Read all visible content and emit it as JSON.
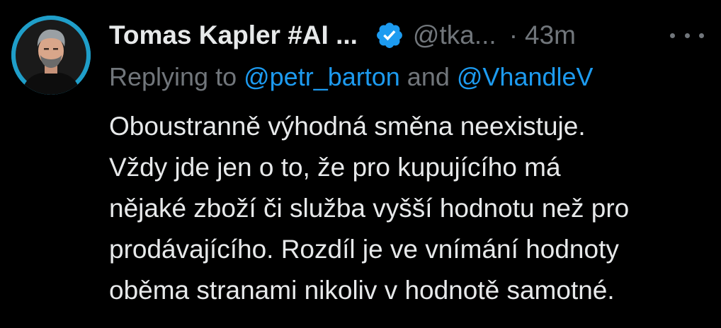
{
  "author": {
    "display_name": "Tomas Kapler #AI ...",
    "handle": "@tka...",
    "separator": "·",
    "time": "43m",
    "verified": true
  },
  "reply_context": {
    "prefix": "Replying to ",
    "mention_1": "@petr_barton",
    "conjunction": " and ",
    "mention_2": "@VhandleV"
  },
  "tweet": {
    "lines": [
      "Oboustranně výhodná směna neexistuje.",
      "Vždy jde jen o to, že pro kupujícího má",
      "nějaké zboží či služba vyšší hodnotu než pro",
      "prodávajícího. Rozdíl je ve vnímání hodnoty",
      "oběma stranami nikoliv v hodnotě samotné."
    ]
  },
  "icons": {
    "avatar": "profile-photo",
    "verified": "verified-check-icon",
    "more": "more-options-icon"
  },
  "colors": {
    "background": "#000000",
    "primary_text": "#e7e9ea",
    "secondary_text": "#71767b",
    "accent": "#1d9bf0",
    "avatar_ring": "#1f9ec9"
  }
}
